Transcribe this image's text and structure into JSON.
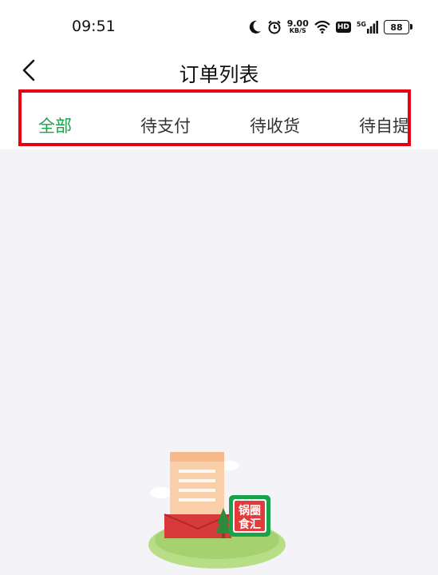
{
  "status_bar": {
    "time": "09:51",
    "net_speed_value": "9.00",
    "net_speed_unit": "KB/S",
    "hd_badge": "HD",
    "network_type": "5G",
    "battery_level": "88"
  },
  "header": {
    "title": "订单列表"
  },
  "tabs": [
    {
      "label": "全部",
      "active": true
    },
    {
      "label": "待支付",
      "active": false
    },
    {
      "label": "待收货",
      "active": false
    },
    {
      "label": "待自提",
      "active": false
    }
  ],
  "empty_state": {
    "illustration_sign_text": "锅圈食汇"
  },
  "colors": {
    "accent": "#1aa14a",
    "highlight_border": "#e60012",
    "content_background": "#f3f3f8"
  }
}
